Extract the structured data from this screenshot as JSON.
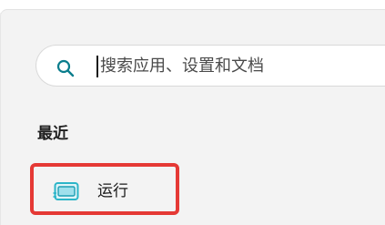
{
  "search": {
    "placeholder": "搜索应用、设置和文档"
  },
  "recent": {
    "title": "最近",
    "items": [
      {
        "label": "运行",
        "icon": "run-dialog-icon"
      }
    ]
  },
  "colors": {
    "accent": "#0067c0",
    "highlight": "#e53935",
    "icon_teal": "#2bb5c8"
  }
}
